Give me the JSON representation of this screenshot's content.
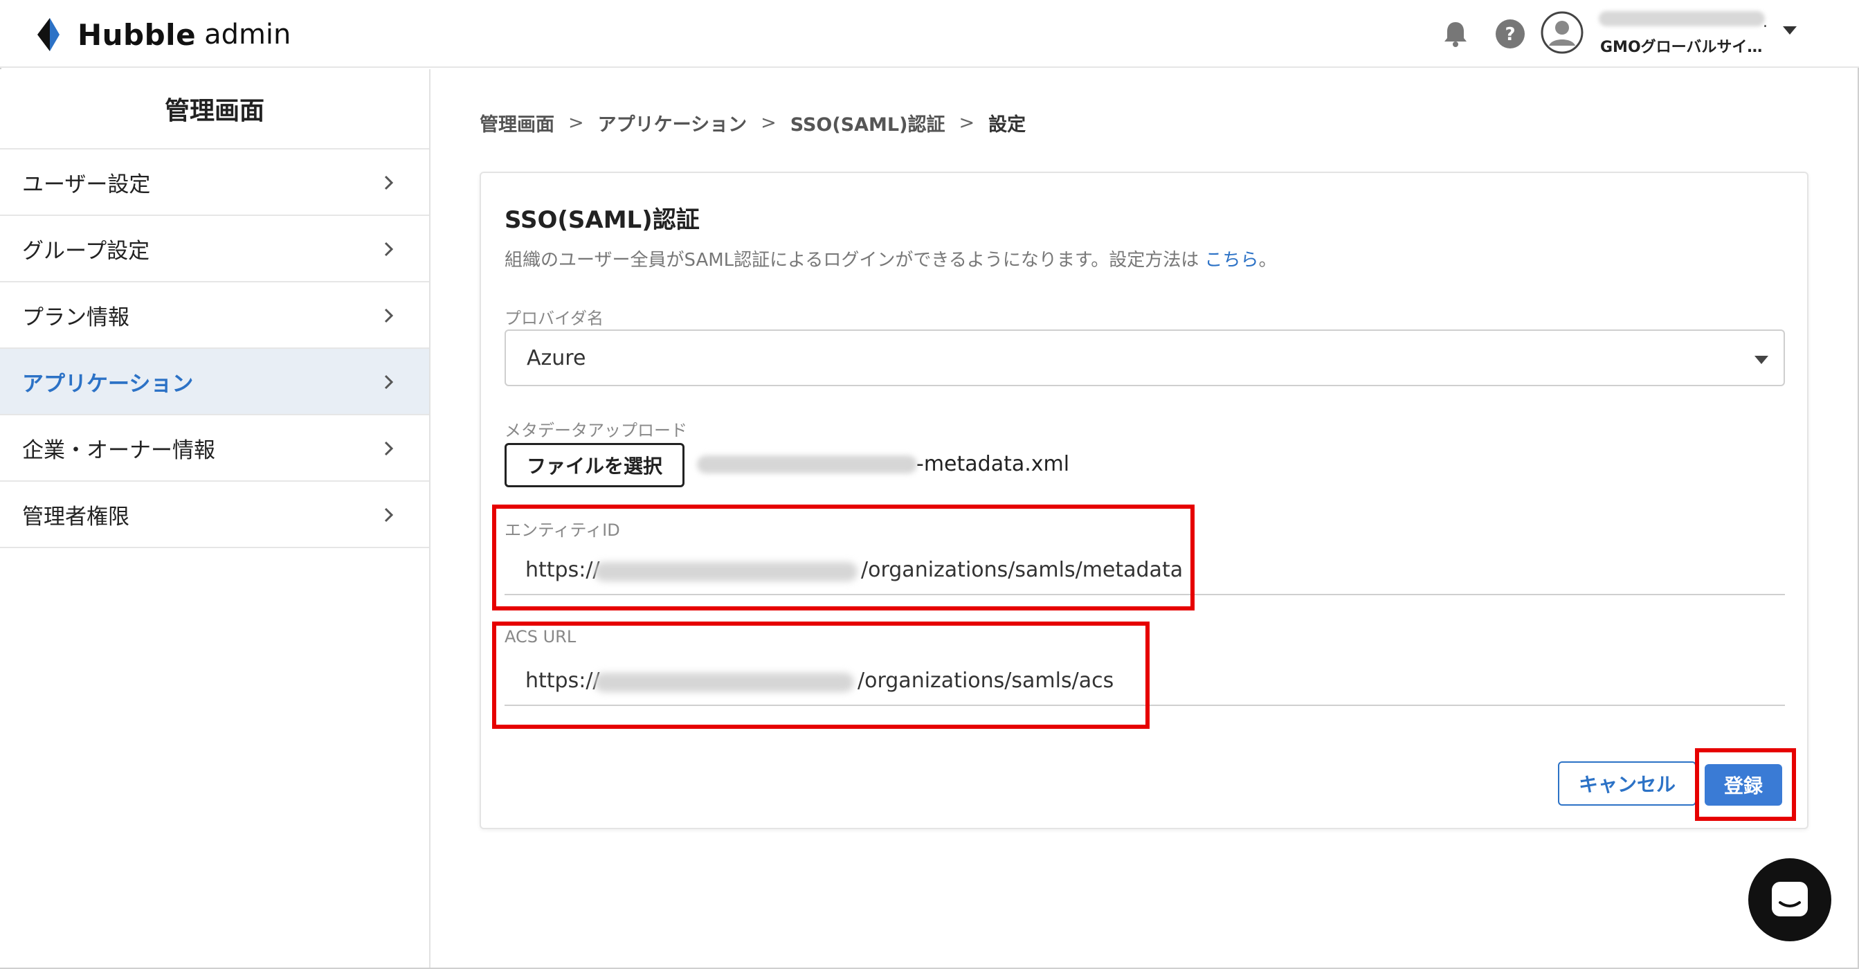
{
  "header": {
    "logo_name": "Hubble",
    "logo_suffix": "admin",
    "org_name": "GMOグローバルサイ…",
    "user_dot": "."
  },
  "sidebar": {
    "title": "管理画面",
    "items": [
      {
        "label": "ユーザー設定",
        "active": false
      },
      {
        "label": "グループ設定",
        "active": false
      },
      {
        "label": "プラン情報",
        "active": false
      },
      {
        "label": "アプリケーション",
        "active": true
      },
      {
        "label": "企業・オーナー情報",
        "active": false
      },
      {
        "label": "管理者権限",
        "active": false
      }
    ]
  },
  "breadcrumb": {
    "items": [
      "管理画面",
      "アプリケーション",
      "SSO(SAML)認証",
      "設定"
    ],
    "separator": ">"
  },
  "card": {
    "title": "SSO(SAML)認証",
    "description": "組織のユーザー全員がSAML認証によるログインができるようになります。設定方法は",
    "description_link": "こちら",
    "description_end": "。",
    "provider": {
      "label": "プロバイダ名",
      "value": "Azure"
    },
    "metadata": {
      "label": "メタデータアップロード",
      "button": "ファイルを選択",
      "file_suffix": "-metadata.xml"
    },
    "entity_id": {
      "label": "エンティティID",
      "prefix": "https://",
      "suffix": "/organizations/samls/metadata"
    },
    "acs_url": {
      "label": "ACS URL",
      "prefix": "https://",
      "suffix": "/organizations/samls/acs"
    },
    "cancel_label": "キャンセル",
    "submit_label": "登録"
  },
  "colors": {
    "accent": "#2c72c6",
    "submit": "#3a7bd5",
    "highlight": "#e60000",
    "active_bg": "#e8eef5"
  }
}
